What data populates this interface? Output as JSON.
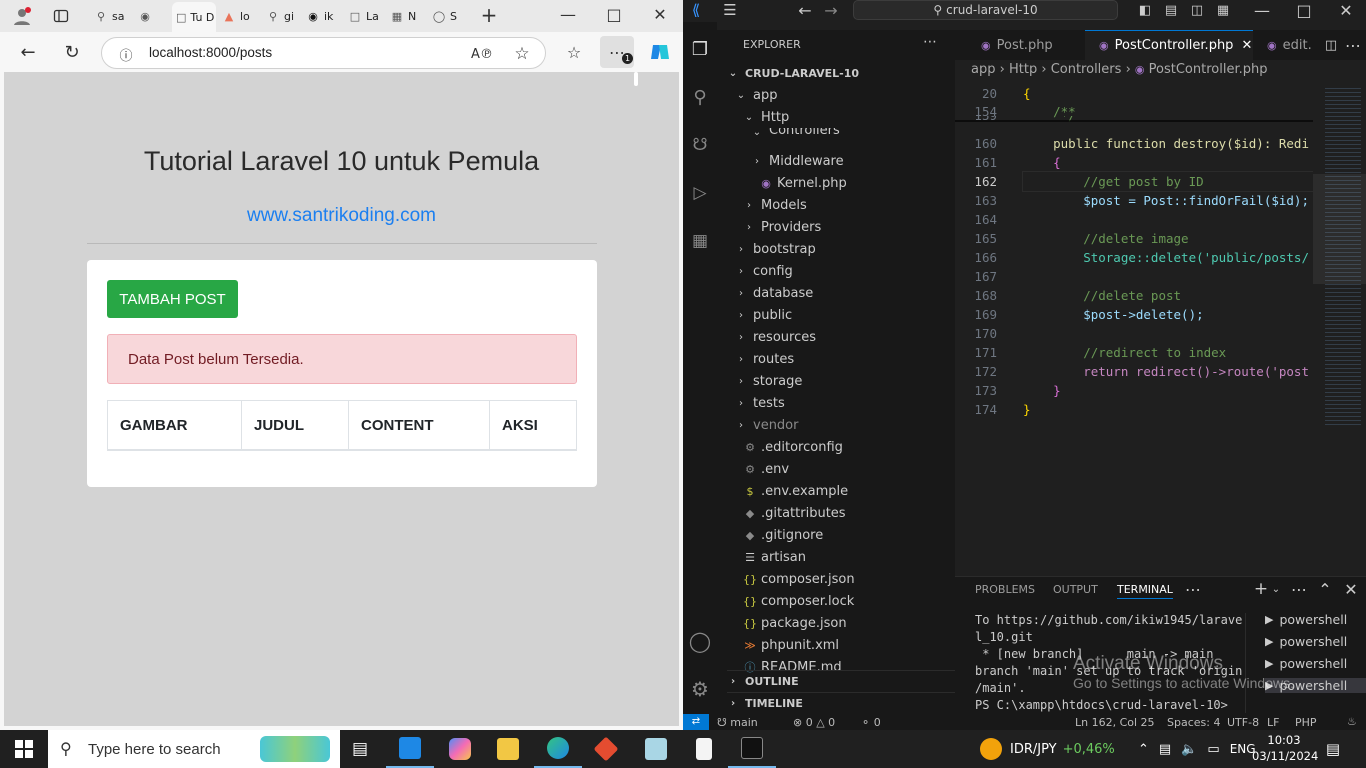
{
  "browser": {
    "tabs": [
      {
        "label": "sa",
        "icon": "search-icon"
      },
      {
        "label": "",
        "icon": "copilot-icon"
      },
      {
        "label": "Tu D",
        "icon": "page-icon",
        "active": true
      },
      {
        "label": "lo",
        "icon": "laravel-icon"
      },
      {
        "label": "gi",
        "icon": "search-icon"
      },
      {
        "label": "ik",
        "icon": "github-icon"
      },
      {
        "label": "La",
        "icon": "page-icon"
      },
      {
        "label": "N",
        "icon": "page-icon"
      },
      {
        "label": "S",
        "icon": "page-icon"
      }
    ],
    "url": "localhost:8000/posts",
    "notification_count": "1"
  },
  "page": {
    "title": "Tutorial Laravel 10 untuk Pemula",
    "link": "www.santrikoding.com",
    "add_button": "TAMBAH POST",
    "alert": "Data Post belum Tersedia.",
    "columns": [
      "GAMBAR",
      "JUDUL",
      "CONTENT",
      "AKSI"
    ]
  },
  "vscode": {
    "search": "crud-laravel-10",
    "explorer_title": "EXPLORER",
    "root": "CRUD-LARAVEL-10",
    "tree": [
      {
        "label": "app",
        "kind": "folder-open",
        "depth": 1
      },
      {
        "label": "Http",
        "kind": "folder-open",
        "depth": 2
      },
      {
        "label": "Controllers",
        "kind": "folder-open",
        "depth": 3
      },
      {
        "label": "Middleware",
        "kind": "folder",
        "depth": 3
      },
      {
        "label": "Kernel.php",
        "kind": "php",
        "depth": 3
      },
      {
        "label": "Models",
        "kind": "folder",
        "depth": 2
      },
      {
        "label": "Providers",
        "kind": "folder",
        "depth": 2
      },
      {
        "label": "bootstrap",
        "kind": "folder",
        "depth": 1
      },
      {
        "label": "config",
        "kind": "folder",
        "depth": 1
      },
      {
        "label": "database",
        "kind": "folder",
        "depth": 1
      },
      {
        "label": "public",
        "kind": "folder",
        "depth": 1
      },
      {
        "label": "resources",
        "kind": "folder",
        "depth": 1
      },
      {
        "label": "routes",
        "kind": "folder",
        "depth": 1
      },
      {
        "label": "storage",
        "kind": "folder",
        "depth": 1
      },
      {
        "label": "tests",
        "kind": "folder",
        "depth": 1
      },
      {
        "label": "vendor",
        "kind": "folder",
        "depth": 1
      },
      {
        "label": ".editorconfig",
        "kind": "gear",
        "depth": 1
      },
      {
        "label": ".env",
        "kind": "gear",
        "depth": 1
      },
      {
        "label": ".env.example",
        "kind": "dollar",
        "depth": 1
      },
      {
        "label": ".gitattributes",
        "kind": "git",
        "depth": 1
      },
      {
        "label": ".gitignore",
        "kind": "git",
        "depth": 1
      },
      {
        "label": "artisan",
        "kind": "lines",
        "depth": 1
      },
      {
        "label": "composer.json",
        "kind": "json",
        "depth": 1
      },
      {
        "label": "composer.lock",
        "kind": "json",
        "depth": 1
      },
      {
        "label": "package.json",
        "kind": "json",
        "depth": 1
      },
      {
        "label": "phpunit.xml",
        "kind": "rss",
        "depth": 1
      },
      {
        "label": "README.md",
        "kind": "info",
        "depth": 1
      }
    ],
    "outline": "OUTLINE",
    "timeline": "TIMELINE",
    "editor_tabs": [
      "Post.php",
      "PostController.php",
      "edit."
    ],
    "breadcrumb": [
      "app",
      "Http",
      "Controllers",
      "PostController.php"
    ],
    "lines": [
      {
        "n": "20",
        "t": "{"
      },
      {
        "n": "154",
        "t": "    /**"
      },
      {
        "n": "159",
        "t": "     */"
      },
      {
        "n": "160",
        "t": "    public function destroy($id): Redi"
      },
      {
        "n": "161",
        "t": "    {"
      },
      {
        "n": "162",
        "t": "        //get post by ID"
      },
      {
        "n": "163",
        "t": "        $post = Post::findOrFail($id);"
      },
      {
        "n": "164",
        "t": ""
      },
      {
        "n": "165",
        "t": "        //delete image"
      },
      {
        "n": "166",
        "t": "        Storage::delete('public/posts/"
      },
      {
        "n": "167",
        "t": ""
      },
      {
        "n": "168",
        "t": "        //delete post"
      },
      {
        "n": "169",
        "t": "        $post->delete();"
      },
      {
        "n": "170",
        "t": ""
      },
      {
        "n": "171",
        "t": "        //redirect to index"
      },
      {
        "n": "172",
        "t": "        return redirect()->route('post"
      },
      {
        "n": "173",
        "t": "    }"
      },
      {
        "n": "174",
        "t": "}"
      }
    ],
    "panel_tabs": [
      "PROBLEMS",
      "OUTPUT",
      "TERMINAL"
    ],
    "terminal": [
      "To https://github.com/ikiw1945/larave",
      "l_10.git",
      " * [new branch]      main -> main",
      "branch 'main' set up to track 'origin",
      "/main'.",
      "PS C:\\xampp\\htdocs\\crud-laravel-10>"
    ],
    "watermark_1": "Activate Windows",
    "watermark_2": "Go to Settings to activate Windows.",
    "terminals": [
      "powershell",
      "powershell",
      "powershell",
      "powershell"
    ],
    "status": {
      "branch": "main",
      "problems": "0",
      "warnings": "0",
      "ports": "0",
      "cursor": "Ln 162, Col 25",
      "spaces": "Spaces: 4",
      "encoding": "UTF-8",
      "eol": "LF",
      "language": "PHP"
    }
  },
  "taskbar": {
    "search_placeholder": "Type here to search",
    "ticker": "IDR/JPY",
    "ticker_change": "+0,46%",
    "language": "ENG",
    "time": "10:03",
    "date": "03/11/2024"
  }
}
